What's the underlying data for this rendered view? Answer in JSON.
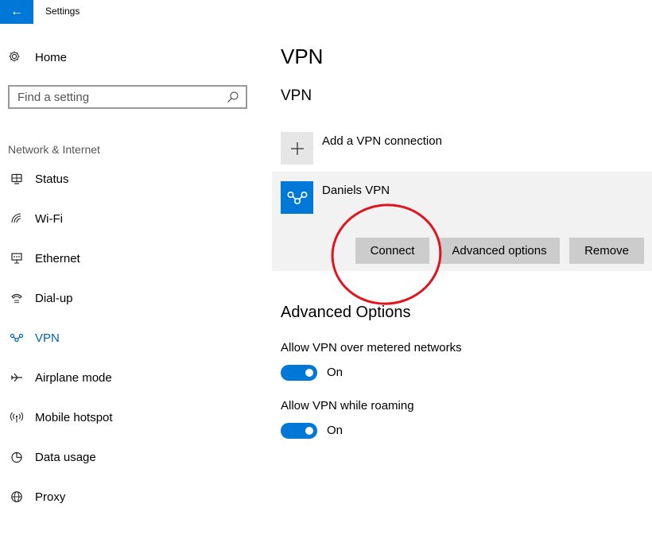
{
  "window": {
    "title": "Settings",
    "back_icon": "arrow-left-icon"
  },
  "sidebar": {
    "home_label": "Home",
    "search_placeholder": "Find a setting",
    "section_label": "Network & Internet",
    "items": [
      {
        "label": "Status",
        "icon": "globe-network-icon"
      },
      {
        "label": "Wi-Fi",
        "icon": "wifi-icon"
      },
      {
        "label": "Ethernet",
        "icon": "ethernet-icon"
      },
      {
        "label": "Dial-up",
        "icon": "dialup-icon"
      },
      {
        "label": "VPN",
        "icon": "vpn-icon",
        "active": true
      },
      {
        "label": "Airplane mode",
        "icon": "airplane-icon"
      },
      {
        "label": "Mobile hotspot",
        "icon": "hotspot-icon"
      },
      {
        "label": "Data usage",
        "icon": "pie-chart-icon"
      },
      {
        "label": "Proxy",
        "icon": "globe-icon"
      }
    ]
  },
  "main": {
    "page_title": "VPN",
    "section_title": "VPN",
    "add_vpn_label": "Add a VPN connection",
    "connection": {
      "name": "Daniels VPN",
      "connect_label": "Connect",
      "advanced_label": "Advanced options",
      "remove_label": "Remove"
    },
    "advanced": {
      "title": "Advanced Options",
      "metered_label": "Allow VPN over metered networks",
      "metered_state": "On",
      "roaming_label": "Allow VPN while roaming",
      "roaming_state": "On"
    }
  },
  "colors": {
    "accent": "#0078d7",
    "annotation": "#e0141e",
    "card_bg": "#f2f2f2",
    "button_bg": "#cccccc"
  }
}
